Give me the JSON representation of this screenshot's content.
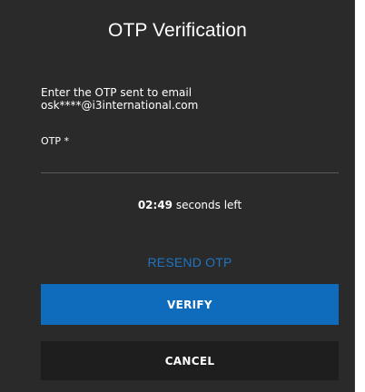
{
  "dialog": {
    "title": "OTP Verification",
    "message_line1": "Enter the OTP sent to email",
    "message_line2": "osk****@i3international.com",
    "otp_label": "OTP *",
    "otp_value": "",
    "timer_value": "02:49",
    "timer_suffix": " seconds left",
    "resend_label": "RESEND OTP",
    "verify_label": "VERIFY",
    "cancel_label": "CANCEL"
  },
  "colors": {
    "dialog_bg": "#2a2a2a",
    "accent": "#0f6cbd",
    "link": "#1f74c4",
    "cancel_bg": "#1e1e1e"
  }
}
